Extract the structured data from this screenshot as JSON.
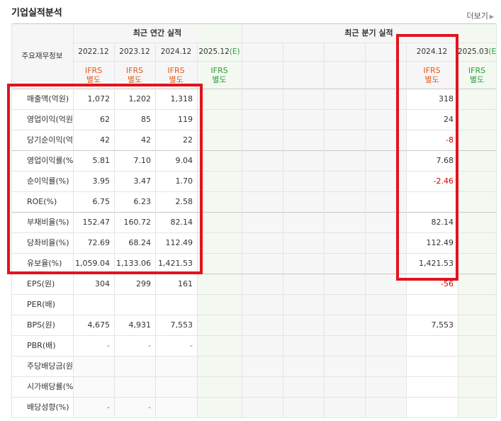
{
  "title": "기업실적분석",
  "more_label": "더보기",
  "header": {
    "row_label": "주요재무정보",
    "annual_title": "최근 연간 실적",
    "quarterly_title": "최근 분기 실적",
    "annual_periods": [
      "2022.12",
      "2023.12",
      "2024.12",
      "2025.12"
    ],
    "annual_estimate_mark": "(E)",
    "quarterly_periods": [
      "",
      "",
      "",
      "",
      "2024.12",
      "2025.03"
    ],
    "quarterly_estimate_mark": "(E)",
    "ifrs_top": "IFRS",
    "ifrs_bottom": "별도"
  },
  "rows": [
    {
      "label": "매출액(억원)",
      "annual": [
        "1,072",
        "1,202",
        "1,318",
        ""
      ],
      "quarterly": [
        "",
        "",
        "",
        "",
        "318",
        ""
      ]
    },
    {
      "label": "영업이익(억원)",
      "annual": [
        "62",
        "85",
        "119",
        ""
      ],
      "quarterly": [
        "",
        "",
        "",
        "",
        "24",
        ""
      ]
    },
    {
      "label": "당기순이익(억원)",
      "annual": [
        "42",
        "42",
        "22",
        ""
      ],
      "quarterly": [
        "",
        "",
        "",
        "",
        "-8",
        ""
      ]
    },
    {
      "label": "영업이익률(%)",
      "annual": [
        "5.81",
        "7.10",
        "9.04",
        ""
      ],
      "quarterly": [
        "",
        "",
        "",
        "",
        "7.68",
        ""
      ]
    },
    {
      "label": "순이익률(%)",
      "annual": [
        "3.95",
        "3.47",
        "1.70",
        ""
      ],
      "quarterly": [
        "",
        "",
        "",
        "",
        "-2.46",
        ""
      ]
    },
    {
      "label": "ROE(%)",
      "annual": [
        "6.75",
        "6.23",
        "2.58",
        ""
      ],
      "quarterly": [
        "",
        "",
        "",
        "",
        "",
        ""
      ]
    },
    {
      "label": "부채비율(%)",
      "annual": [
        "152.47",
        "160.72",
        "82.14",
        ""
      ],
      "quarterly": [
        "",
        "",
        "",
        "",
        "82.14",
        ""
      ]
    },
    {
      "label": "당좌비율(%)",
      "annual": [
        "72.69",
        "68.24",
        "112.49",
        ""
      ],
      "quarterly": [
        "",
        "",
        "",
        "",
        "112.49",
        ""
      ]
    },
    {
      "label": "유보율(%)",
      "annual": [
        "1,059.04",
        "1,133.06",
        "1,421.53",
        ""
      ],
      "quarterly": [
        "",
        "",
        "",
        "",
        "1,421.53",
        ""
      ]
    },
    {
      "label": "EPS(원)",
      "annual": [
        "304",
        "299",
        "161",
        ""
      ],
      "quarterly": [
        "",
        "",
        "",
        "",
        "-56",
        ""
      ]
    },
    {
      "label": "PER(배)",
      "annual": [
        "",
        "",
        "",
        ""
      ],
      "quarterly": [
        "",
        "",
        "",
        "",
        "",
        ""
      ]
    },
    {
      "label": "BPS(원)",
      "annual": [
        "4,675",
        "4,931",
        "7,553",
        ""
      ],
      "quarterly": [
        "",
        "",
        "",
        "",
        "7,553",
        ""
      ]
    },
    {
      "label": "PBR(배)",
      "annual": [
        "-",
        "-",
        "-",
        ""
      ],
      "quarterly": [
        "",
        "",
        "",
        "",
        "",
        ""
      ]
    },
    {
      "label": "주당배당금(원)",
      "annual": [
        "",
        "",
        "",
        ""
      ],
      "quarterly": [
        "",
        "",
        "",
        "",
        "",
        ""
      ]
    },
    {
      "label": "시가배당률(%)",
      "annual": [
        "",
        "",
        "",
        ""
      ],
      "quarterly": [
        "",
        "",
        "",
        "",
        "",
        ""
      ]
    },
    {
      "label": "배당성향(%)",
      "annual": [
        "-",
        "-",
        "",
        ""
      ],
      "quarterly": [
        "",
        "",
        "",
        "",
        "",
        ""
      ]
    }
  ],
  "colors": {
    "negative": "#d40000",
    "ifrs": "#e15a1a",
    "estimate": "#2a9c3a",
    "estimate_shade": "#f3f9f1",
    "header_shade": "#f6f6f6",
    "highlight_box": "#e1141e"
  }
}
